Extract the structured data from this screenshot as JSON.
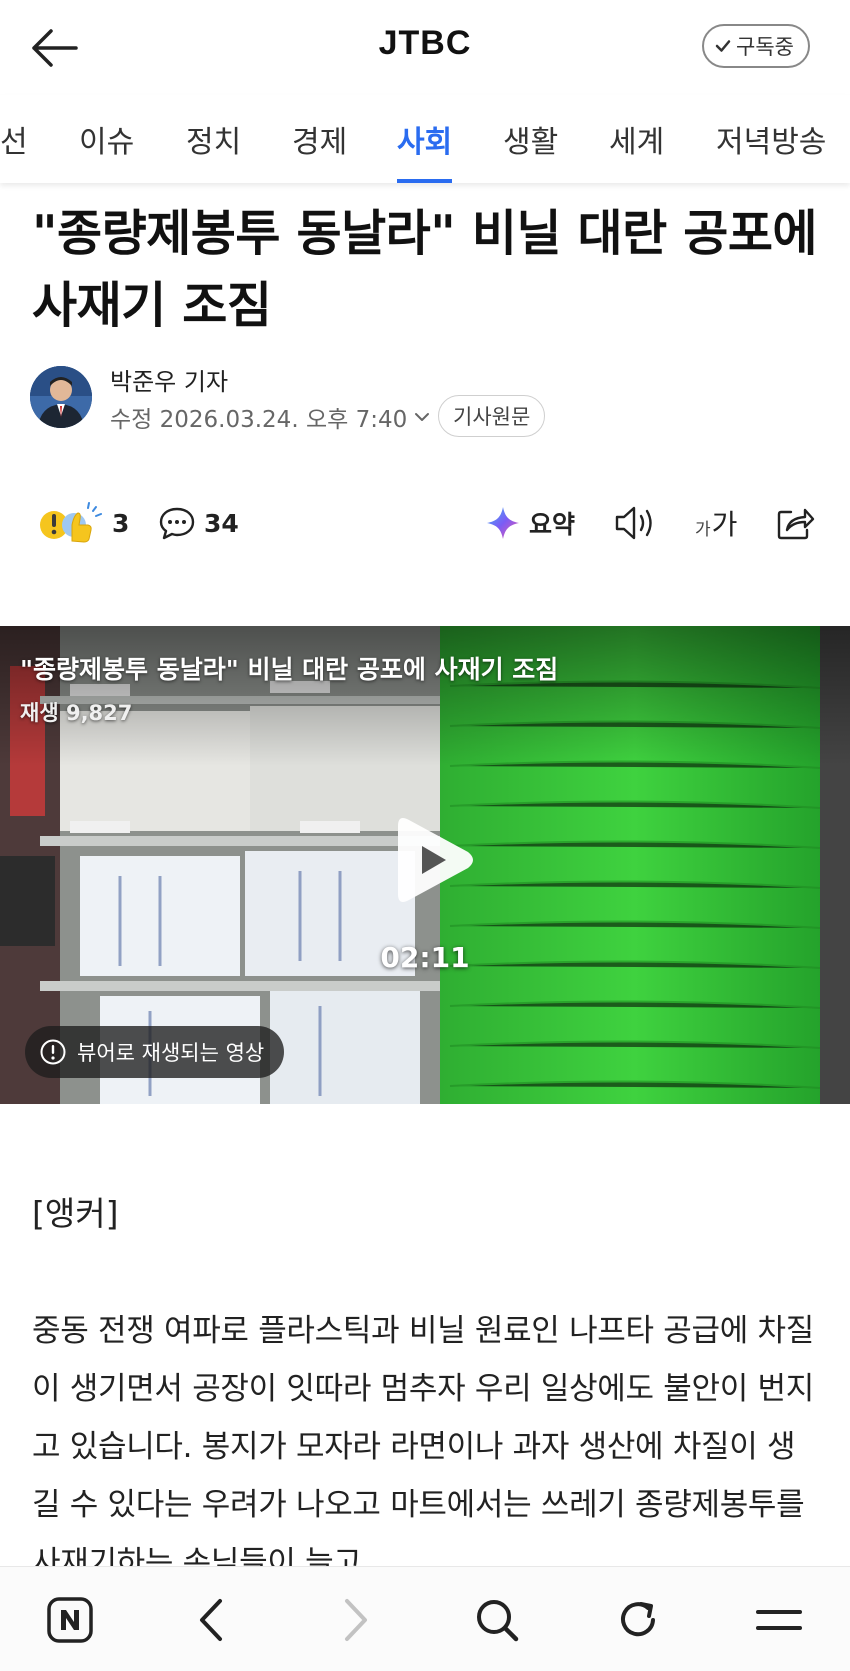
{
  "header": {
    "brand": "JTBC",
    "subscribe_label": "구독중"
  },
  "tabs": [
    {
      "label": "선"
    },
    {
      "label": "이슈"
    },
    {
      "label": "정치"
    },
    {
      "label": "경제"
    },
    {
      "label": "사회",
      "active": true
    },
    {
      "label": "생활"
    },
    {
      "label": "세계"
    },
    {
      "label": "저녁방송"
    }
  ],
  "article": {
    "title": "\"종량제봉투 동날라\" 비닐 대란 공포에 사재기 조짐",
    "reporter": "박준우 기자",
    "modified": "수정 2026.03.24. 오후 7:40",
    "original_label": "기사원문"
  },
  "actions": {
    "reactions_count": "3",
    "comments_count": "34",
    "summary_label": "요약",
    "font_small": "가",
    "font_large": "가"
  },
  "video": {
    "title": "\"종량제봉투 동날라\" 비닐 대란 공포에 사재기 조짐",
    "views": "재생 9,827",
    "duration": "02:11",
    "blur_notice": "뷰어로 재생되는 영상"
  },
  "body": {
    "anchor_tag": "[앵커]",
    "paragraph": "중동 전쟁 여파로 플라스틱과 비닐 원료인 나프타 공급에 차질이 생기면서 공장이 잇따라 멈추자 우리 일상에도 불안이 번지고 있습니다. 봉지가 모자라 라면이나 과자 생산에 차질이 생길 수 있다는 우려가 나오고 마트에서는 쓰레기 종량제봉투를 사재기하는 손님들이 늘고"
  },
  "colors": {
    "accent": "#2a6cf0",
    "text": "#111111",
    "muted": "#666666"
  },
  "icons": {
    "back": "arrow-left-icon",
    "check": "check-icon",
    "reaction": "reaction-emoji-icon",
    "comment": "comment-bubble-icon",
    "summary": "ai-sparkle-icon",
    "tts": "speaker-icon",
    "font": "font-size-icon",
    "share": "share-icon",
    "play": "play-icon",
    "info": "info-circle-icon",
    "nav_home": "naver-n-icon",
    "nav_back": "chevron-left-icon",
    "nav_forward": "chevron-right-icon",
    "nav_search": "search-icon",
    "nav_refresh": "refresh-icon",
    "nav_menu": "menu-icon"
  }
}
